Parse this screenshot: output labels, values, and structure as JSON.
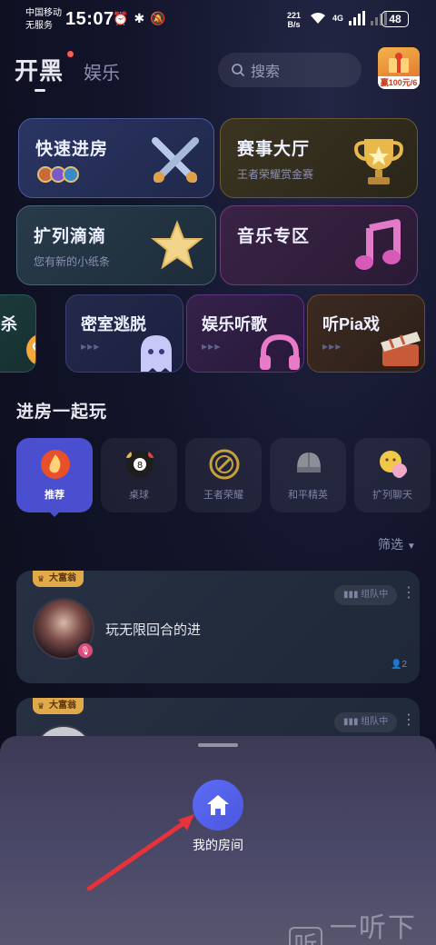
{
  "status_bar": {
    "carrier_line1": "中国移动",
    "carrier_line2": "无服务",
    "time": "15:07",
    "net_speed_value": "221",
    "net_speed_unit": "B/s",
    "network_type": "4G",
    "battery": "48"
  },
  "header": {
    "tab_main": "开黑",
    "tab_second": "娱乐",
    "search_placeholder": "搜索",
    "promo_label": "赢100元/6"
  },
  "feature_cards": [
    {
      "title": "快速进房",
      "subtitle": ""
    },
    {
      "title": "赛事大厅",
      "subtitle": "王者荣耀赏金赛"
    },
    {
      "title": "扩列滴滴",
      "subtitle": "您有新的小纸条"
    },
    {
      "title": "音乐专区",
      "subtitle": ""
    }
  ],
  "small_cards": [
    {
      "title": "杀"
    },
    {
      "title": "密室逃脱"
    },
    {
      "title": "娱乐听歌"
    },
    {
      "title": "听Pia戏"
    }
  ],
  "section_title": "进房一起玩",
  "categories": [
    {
      "label": "推荐",
      "active": true,
      "color": "#e8502a"
    },
    {
      "label": "桌球",
      "active": false,
      "color": "#2a2a2a"
    },
    {
      "label": "王者荣耀",
      "active": false,
      "color": "#c8a03a"
    },
    {
      "label": "和平精英",
      "active": false,
      "color": "#8a8f98"
    },
    {
      "label": "扩列聊天",
      "active": false,
      "color": "#f2c84a"
    }
  ],
  "filter_label": "筛选",
  "rooms": [
    {
      "badge": "大富翁",
      "status": "组队中",
      "name": "玩无限回合的进",
      "count": "2"
    },
    {
      "badge": "大富翁",
      "status": "组队中",
      "name": "",
      "count": ""
    }
  ],
  "bottom_sheet": {
    "button_label": "我的房间"
  },
  "watermark": {
    "icon_char": "听",
    "text": "一听下载"
  },
  "colors": {
    "accent": "#4a4fcf",
    "home_button": "#5e6cf5",
    "arrow": "#e8323a"
  }
}
